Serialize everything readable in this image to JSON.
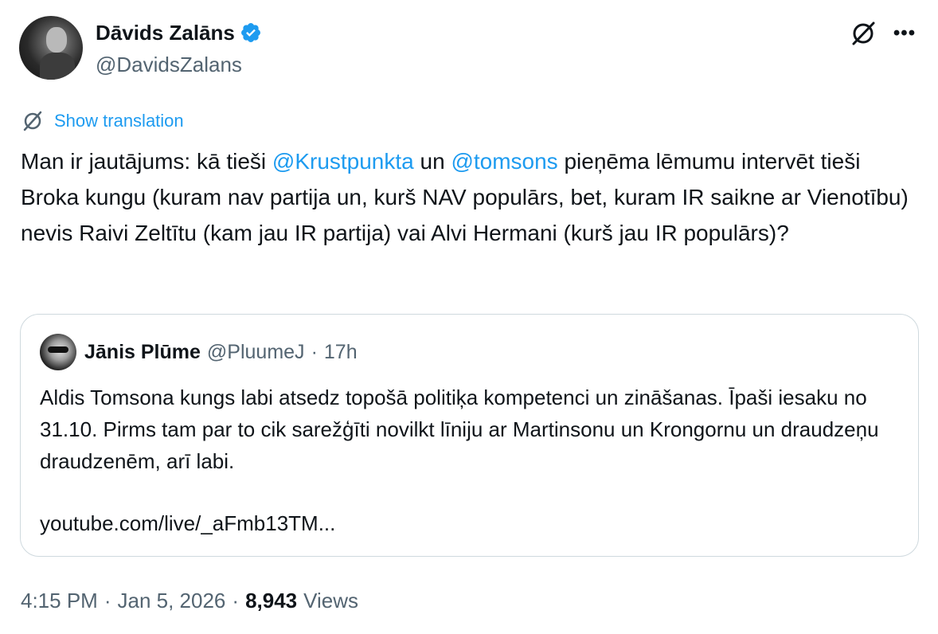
{
  "author": {
    "name": "Dāvids Zalāns",
    "handle": "@DavidsZalans",
    "verified_color": "#1d9bf0"
  },
  "icons": {
    "grok": "grok-icon",
    "more": "more-options-icon",
    "more_glyph": "•••",
    "translate": "translate-icon"
  },
  "translation": {
    "label": "Show translation"
  },
  "tweet": {
    "text_1": "Man ir jautājums: kā tieši ",
    "mention_1": "@Krustpunkta",
    "text_2": " un ",
    "mention_2": "@tomsons",
    "text_3": " pieņēma lēmumu intervēt tieši Broka kungu (kuram nav partija un, kurš NAV populārs, bet, kuram IR saikne ar Vienotību) nevis Raivi Zeltītu (kam jau IR partija) vai Alvi Hermani (kurš jau IR populārs)?"
  },
  "quote": {
    "name": "Jānis Plūme",
    "handle": "@PluumeJ",
    "separator": "·",
    "time": "17h",
    "text": "Aldis Tomsona kungs labi atsedz topošā politiķa kompetenci un zināšanas. Īpaši iesaku no 31.10. Pirms tam par to cik sarežģīti novilkt līniju ar Martinsonu un Krongornu un draudzeņu draudzenēm, arī labi.",
    "link": "youtube.com/live/_aFmb13TM..."
  },
  "meta": {
    "time": "4:15 PM",
    "sep_1": "·",
    "date": "Jan 5, 2026",
    "sep_2": "·",
    "views_count": "8,943",
    "views_label": "Views"
  },
  "colors": {
    "accent": "#1d9bf0",
    "text": "#0f1419",
    "secondary": "#536471",
    "border": "#cfd9de"
  }
}
